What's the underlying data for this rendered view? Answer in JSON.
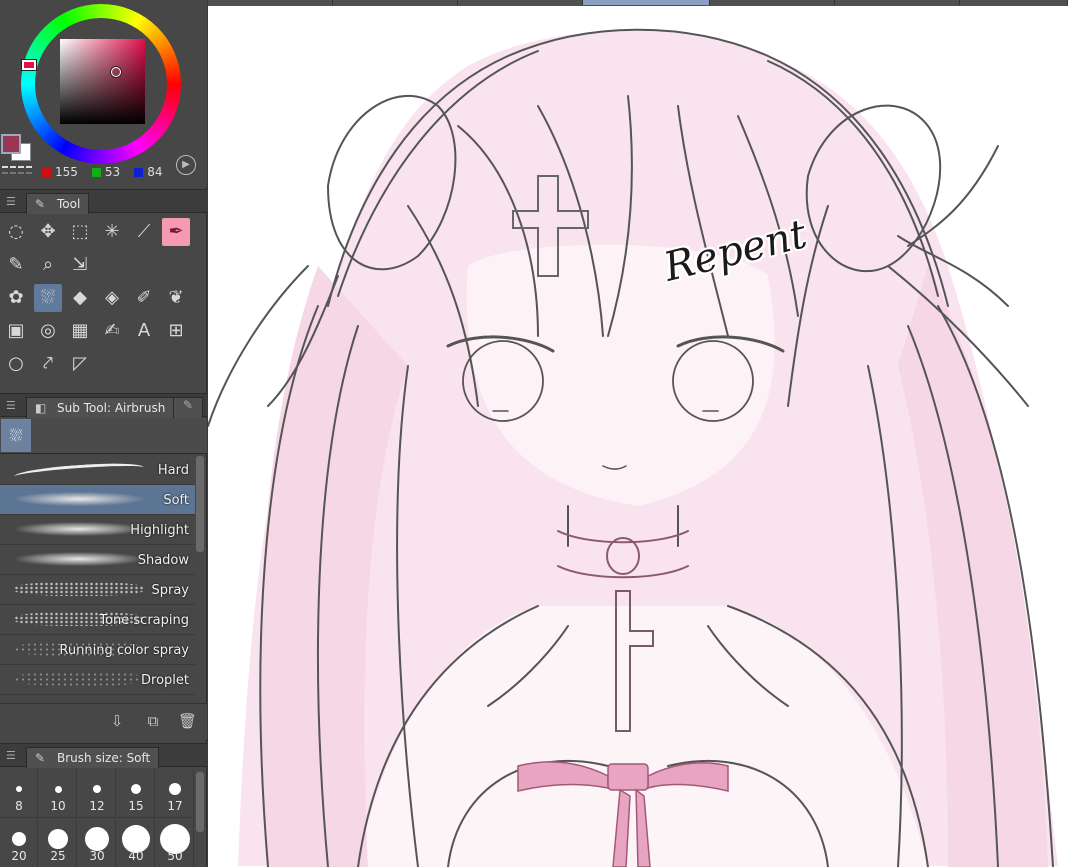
{
  "color": {
    "r": "155",
    "g": "53",
    "b": "84",
    "foreground_hex": "#9b3554",
    "background_hex": "#ffffff",
    "hue_hex": "#e0104a"
  },
  "tool_panel": {
    "tab_label": "Tool",
    "tools": [
      {
        "name": "lasso-select-icon",
        "glyph": "◌"
      },
      {
        "name": "move-icon",
        "glyph": "✥"
      },
      {
        "name": "rect-select-icon",
        "glyph": "⬚"
      },
      {
        "name": "magic-wand-icon",
        "glyph": "✳"
      },
      {
        "name": "eyedropper-icon",
        "glyph": "⟋"
      },
      {
        "name": "pen-icon",
        "glyph": "✒"
      },
      {
        "name": "pencil-icon",
        "glyph": "✎"
      },
      {
        "name": "zoom-icon",
        "glyph": "⌕"
      },
      {
        "name": "object-select-icon",
        "glyph": "⇲"
      },
      {
        "name": "brush-icon",
        "glyph": "✿"
      },
      {
        "name": "airbrush-icon",
        "glyph": "⛆"
      },
      {
        "name": "eraser-icon",
        "glyph": "◆"
      },
      {
        "name": "fill-icon",
        "glyph": "◈"
      },
      {
        "name": "decoration-icon",
        "glyph": "✐"
      },
      {
        "name": "blend-icon",
        "glyph": "❦"
      },
      {
        "name": "gradient-icon",
        "glyph": "▣"
      },
      {
        "name": "figure-icon",
        "glyph": "◎"
      },
      {
        "name": "frame-icon",
        "glyph": "▦"
      },
      {
        "name": "ruler-icon",
        "glyph": "✍"
      },
      {
        "name": "text-icon",
        "glyph": "A"
      },
      {
        "name": "balloon-icon",
        "glyph": "⊞"
      },
      {
        "name": "speech-balloon-icon",
        "glyph": "○"
      },
      {
        "name": "correct-line-icon",
        "glyph": "⤤"
      },
      {
        "name": "flow-line-icon",
        "glyph": "◸"
      }
    ]
  },
  "subtool_panel": {
    "tab_label": "Sub Tool: Airbrush",
    "items": [
      {
        "label": "Hard",
        "style": "hard"
      },
      {
        "label": "Soft",
        "style": "soft",
        "selected": true
      },
      {
        "label": "Highlight",
        "style": "soft"
      },
      {
        "label": "Shadow",
        "style": "soft"
      },
      {
        "label": "Spray",
        "style": "spray"
      },
      {
        "label": "Tone scraping",
        "style": "spray"
      },
      {
        "label": "Running color spray",
        "style": "dots"
      },
      {
        "label": "Droplet",
        "style": "dots"
      }
    ]
  },
  "brush_size_panel": {
    "tab_label": "Brush size: Soft",
    "sizes": [
      "8",
      "10",
      "12",
      "15",
      "17",
      "20",
      "25",
      "30",
      "40",
      "50"
    ]
  },
  "canvas": {
    "sticker_text": "Repent"
  }
}
